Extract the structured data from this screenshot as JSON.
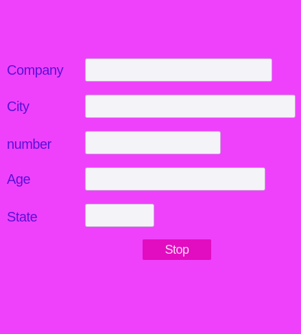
{
  "form": {
    "fields": [
      {
        "label": "Company",
        "value": ""
      },
      {
        "label": "City",
        "value": ""
      },
      {
        "label": "number",
        "value": ""
      },
      {
        "label": "Age",
        "value": ""
      },
      {
        "label": "State",
        "value": ""
      }
    ],
    "stop_label": "Stop"
  },
  "colors": {
    "background": "#ef41fb",
    "label": "#5a10d8",
    "button": "#e20cc0"
  }
}
